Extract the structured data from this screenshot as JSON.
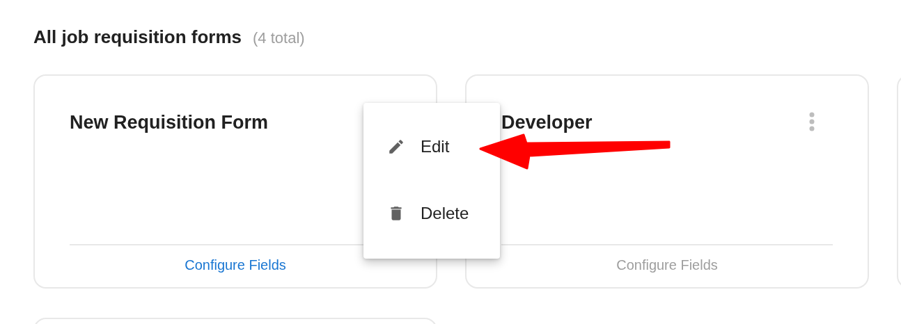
{
  "heading": {
    "title": "All job requisition forms",
    "count": "(4 total)"
  },
  "cards": [
    {
      "kind": "full",
      "title": "New Requisition Form",
      "link": "Configure Fields",
      "disabled": false,
      "menu_open": true
    },
    {
      "kind": "full",
      "title": "Developer",
      "link": "Configure Fields",
      "disabled": true,
      "menu_open": false
    },
    {
      "kind": "partial"
    },
    {
      "kind": "partial"
    }
  ],
  "menu": {
    "items": [
      {
        "label": "Edit"
      },
      {
        "label": "Delete"
      }
    ]
  },
  "annotation": {
    "kind": "arrow"
  }
}
